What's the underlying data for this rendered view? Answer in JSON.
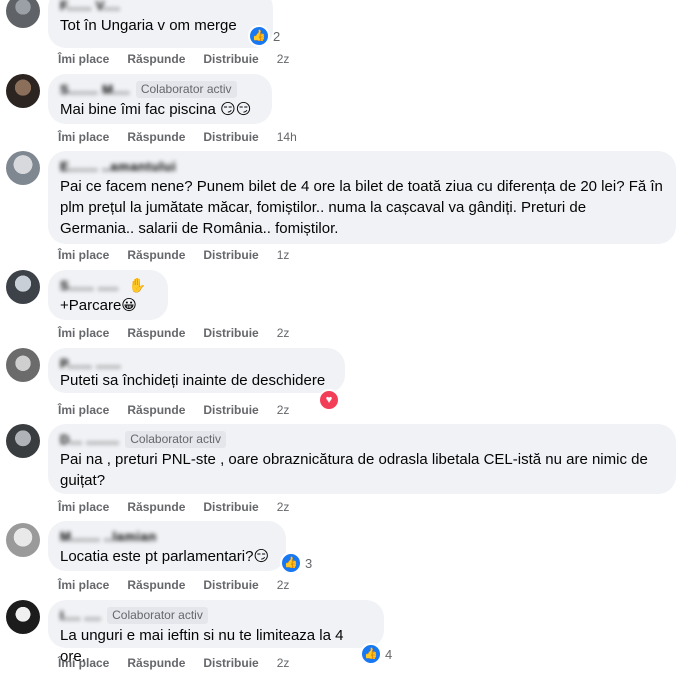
{
  "action_labels": {
    "like": "Îmi place",
    "reply": "Răspunde",
    "share": "Distribuie"
  },
  "comments": [
    {
      "author": "F...... V....",
      "badge": "",
      "text": "Tot în Ungaria v om merge",
      "emoji": "",
      "time": "2z",
      "reaction": {
        "type": "like",
        "count": "2"
      }
    },
    {
      "author": "S....... M....",
      "badge": "Colaborator activ",
      "text": "Mai bine îmi fac piscina",
      "emoji": "😏😏",
      "time": "14h",
      "reaction": null
    },
    {
      "author": "E....... ..amantului",
      "badge": "",
      "text": "Pai ce facem nene? Punem bilet de 4 ore la bilet de toată ziua cu diferența de 20 lei? Fă în plm prețul la jumătate măcar, fomiștilor.. numa la cașcaval va gândiți. Preturi de Germania.. salarii de România.. fomiștilor.",
      "emoji": "",
      "time": "1z",
      "reaction": null
    },
    {
      "author": "S...... .....",
      "badge": "",
      "text": "+Parcare",
      "emoji": "😀",
      "time": "2z",
      "reaction": null
    },
    {
      "author": "P...... ......",
      "badge": "",
      "text": "Puteti sa închideți inainte de deschidere",
      "emoji": "",
      "time": "2z",
      "reaction": {
        "type": "love",
        "count": ""
      }
    },
    {
      "author": "D... ........",
      "badge": "Colaborator activ",
      "text": "Pai na , preturi PNL-ste , oare obraznicătura de odrasla libetala CEL-istă nu are nimic de guițat?",
      "emoji": "",
      "time": "2z",
      "reaction": null
    },
    {
      "author": "M....... ..lamian",
      "badge": "",
      "text": "Locatia este pt parlamentari?",
      "emoji": "😏",
      "time": "2z",
      "reaction": {
        "type": "like",
        "count": "3"
      }
    },
    {
      "author": "I.... ....",
      "badge": "Colaborator activ",
      "text": "La unguri e mai ieftin si nu te limiteaza la 4 ore.",
      "emoji": "",
      "time": "2z",
      "reaction": {
        "type": "like",
        "count": "4"
      }
    }
  ]
}
